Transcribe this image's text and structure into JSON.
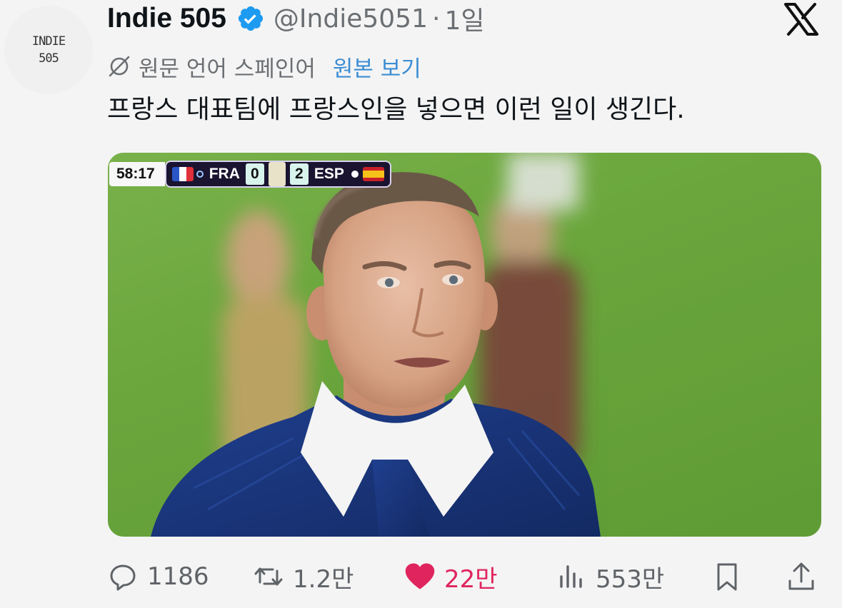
{
  "avatar": {
    "line1": "INDIE",
    "line2": "505"
  },
  "header": {
    "display_name": "Indie 505",
    "handle": "@Indie5051",
    "separator": "·",
    "time": "1일"
  },
  "translation": {
    "note": "원문 언어 스페인어",
    "show_original": "원본 보기"
  },
  "tweet": {
    "text": "프랑스 대표팀에 프랑스인을 넣으면 이런 일이 생긴다."
  },
  "media": {
    "scoreboard": {
      "clock": "58:17",
      "home_team": "FRA",
      "home_score": "0",
      "away_score": "2",
      "away_team": "ESP"
    }
  },
  "actions": {
    "replies": "1186",
    "reposts": "1.2만",
    "likes": "22만",
    "views": "553만"
  },
  "colors": {
    "accent_blue": "#1d9bf0",
    "like_pink": "#e0245e",
    "link_blue": "#3b8dd3",
    "muted_gray": "#6b6f73"
  },
  "icons": {
    "verified": "verified-badge-icon",
    "brand": "x-logo-icon",
    "translate": "globe-icon",
    "reply": "reply-icon",
    "repost": "repost-icon",
    "like": "heart-icon",
    "views": "views-icon",
    "bookmark": "bookmark-icon",
    "share": "share-icon"
  }
}
